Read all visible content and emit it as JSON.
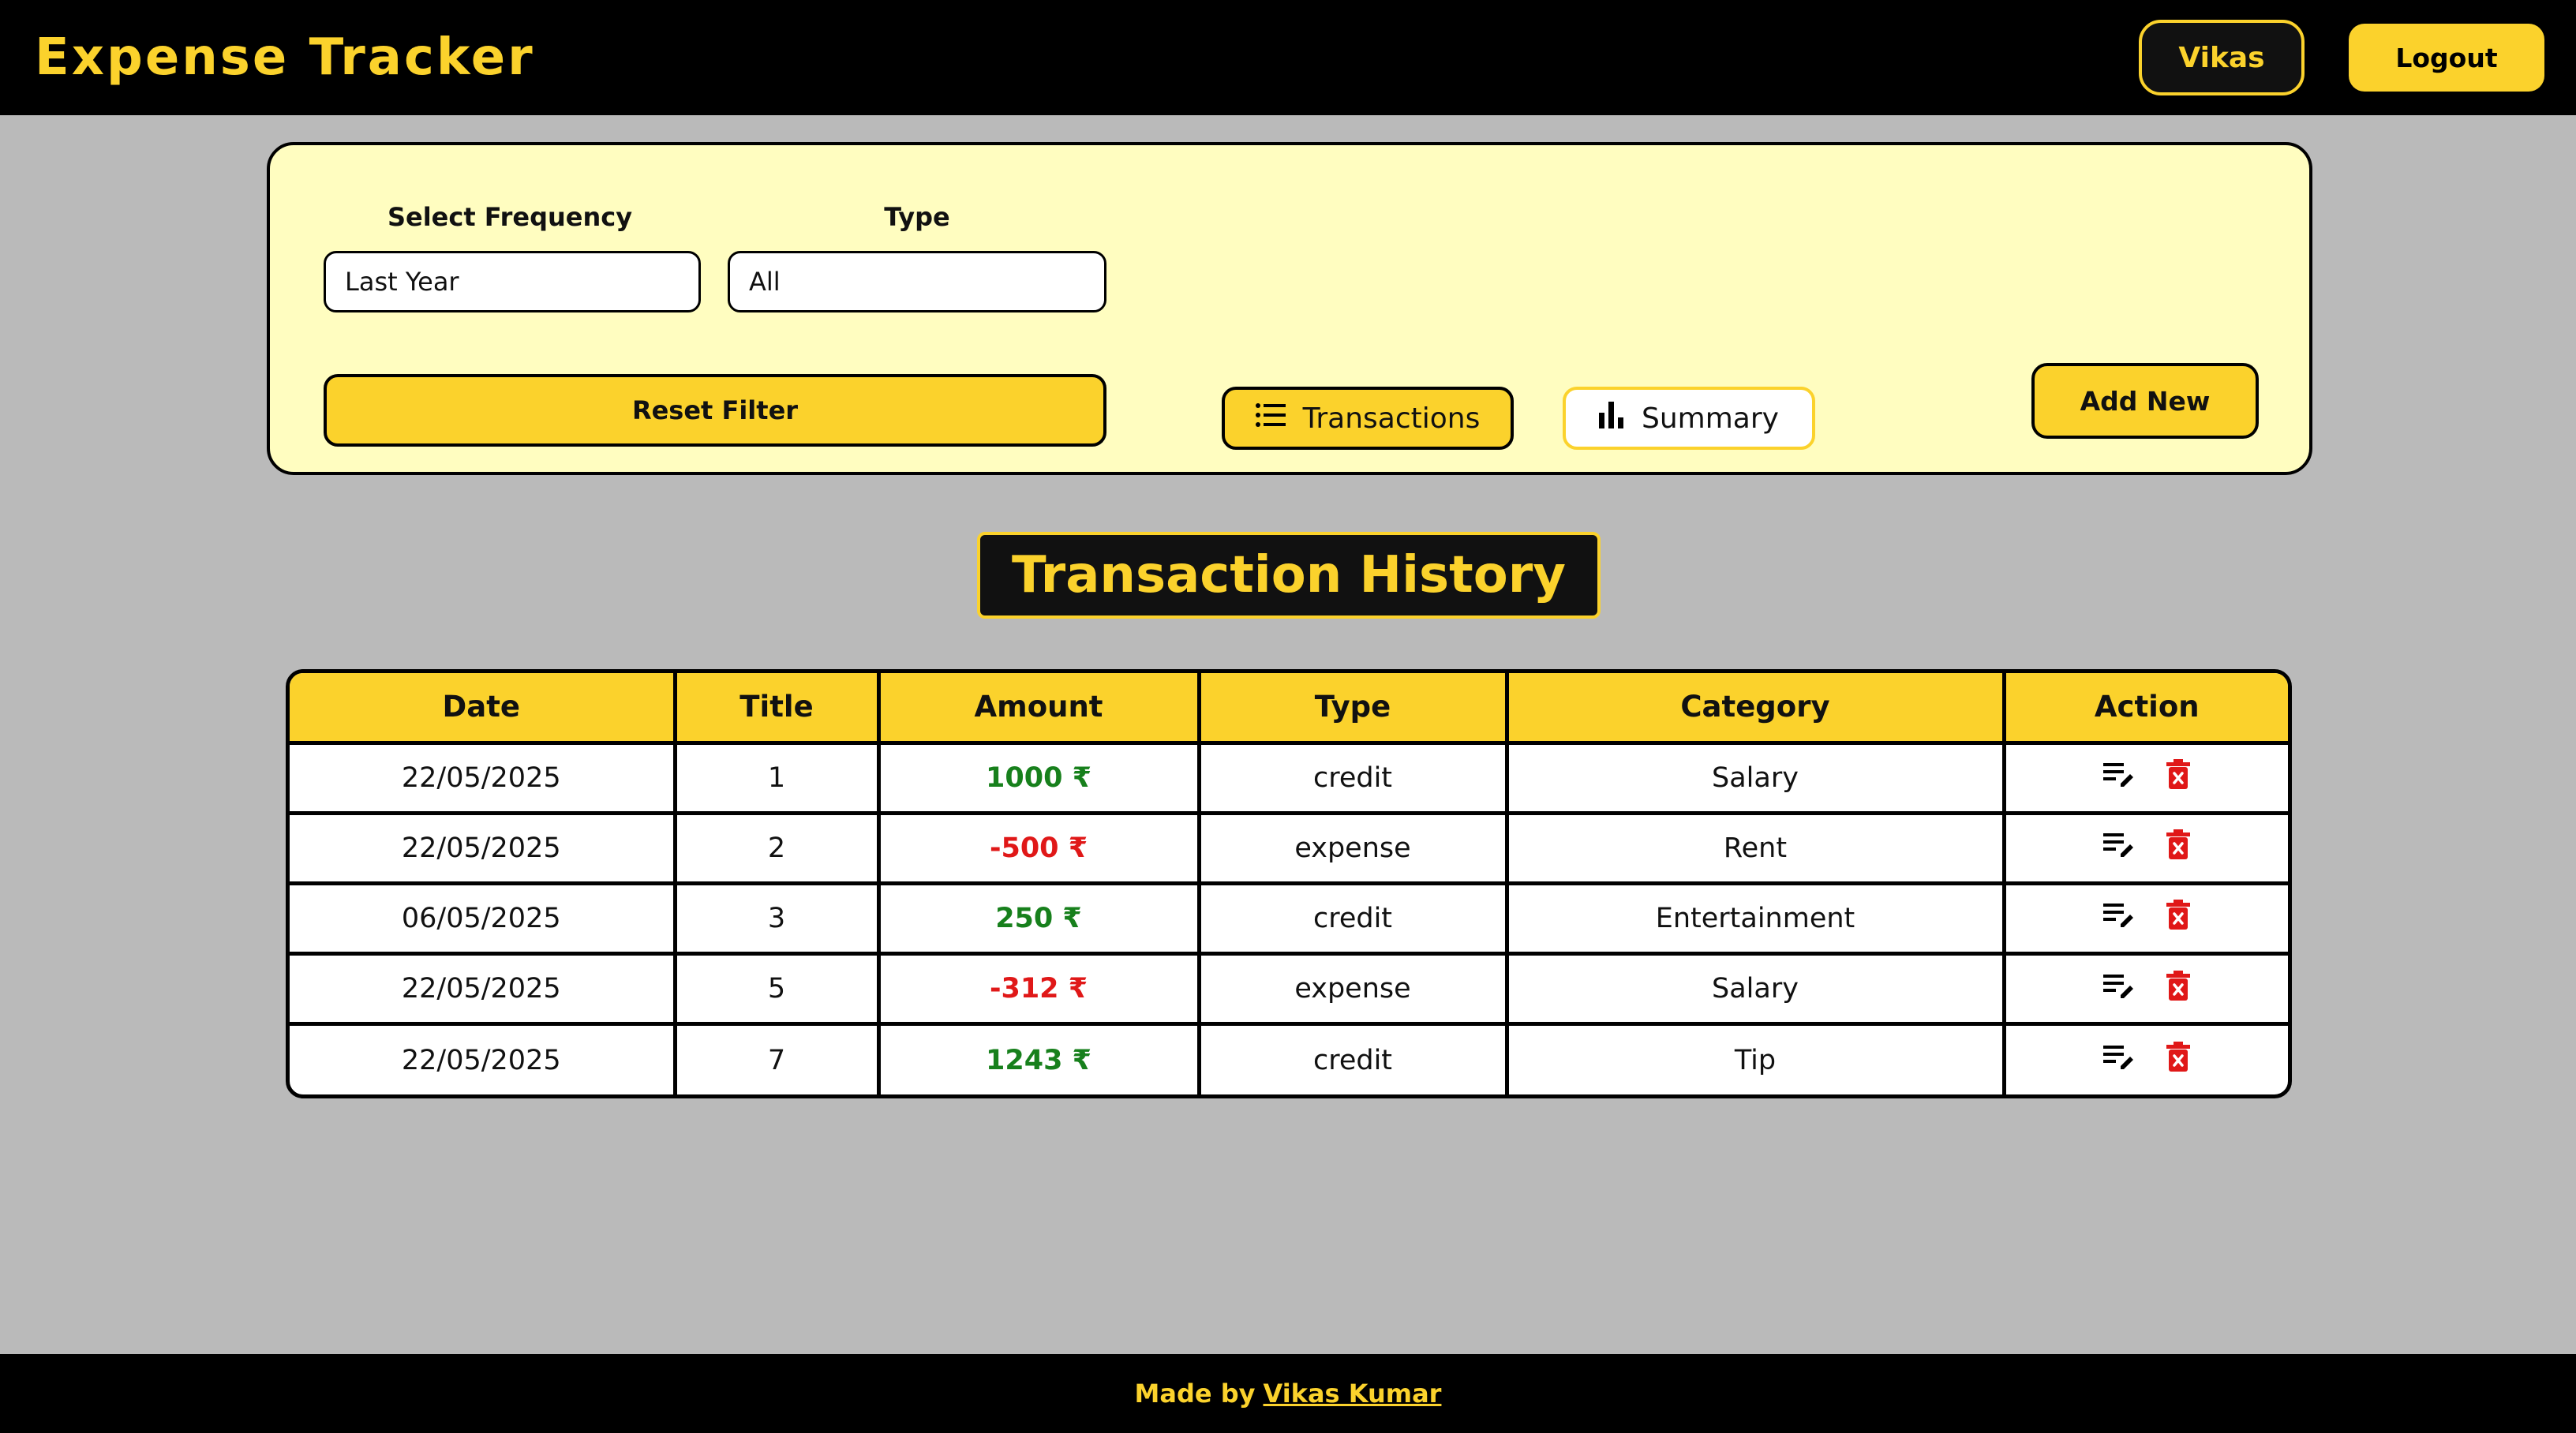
{
  "header": {
    "brand": "Expense Tracker",
    "user_label": "Vikas",
    "logout_label": "Logout"
  },
  "filters": {
    "frequency_label": "Select Frequency",
    "frequency_value": "Last Year",
    "type_label": "Type",
    "type_value": "All",
    "reset_label": "Reset Filter",
    "transactions_label": "Transactions",
    "summary_label": "Summary",
    "add_new_label": "Add New"
  },
  "history_title": "Transaction History",
  "table": {
    "headers": [
      "Date",
      "Title",
      "Amount",
      "Type",
      "Category",
      "Action"
    ],
    "rows": [
      {
        "date": "22/05/2025",
        "title": "1",
        "amount": "1000 ₹",
        "type": "credit",
        "category": "Salary"
      },
      {
        "date": "22/05/2025",
        "title": "2",
        "amount": "-500 ₹",
        "type": "expense",
        "category": "Rent"
      },
      {
        "date": "06/05/2025",
        "title": "3",
        "amount": "250 ₹",
        "type": "credit",
        "category": "Entertainment"
      },
      {
        "date": "22/05/2025",
        "title": "5",
        "amount": "-312 ₹",
        "type": "expense",
        "category": "Salary"
      },
      {
        "date": "22/05/2025",
        "title": "7",
        "amount": "1243 ₹",
        "type": "credit",
        "category": "Tip"
      }
    ]
  },
  "footer": {
    "made_by": "Made by",
    "author": "Vikas Kumar"
  },
  "colors": {
    "accent": "#fbd22c",
    "credit": "#17801c",
    "expense": "#e01818",
    "panel": "#fffdc0",
    "background": "#bababa"
  },
  "icons": {
    "transactions": "list-icon",
    "summary": "bar-chart-icon",
    "edit": "edit-note-icon",
    "delete": "delete-icon"
  }
}
